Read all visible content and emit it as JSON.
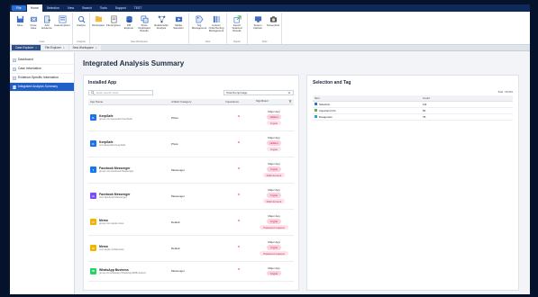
{
  "ribbon_tabs": {
    "file": "File",
    "tabs": [
      "Home",
      "Selection",
      "View",
      "Search",
      "Tools",
      "Support",
      "TEST"
    ]
  },
  "ribbon_groups": [
    {
      "name": "Case",
      "buttons": [
        {
          "label": "Save",
          "icon": "save-icon"
        },
        {
          "label": "Close Case",
          "icon": "close-case-icon"
        },
        {
          "label": "Add Evidence",
          "icon": "add-evidence-icon"
        },
        {
          "label": "Case Explorer",
          "icon": "case-explorer-icon"
        }
      ]
    },
    {
      "name": "Analysis",
      "buttons": [
        {
          "label": "Analyze",
          "icon": "analyze-icon"
        }
      ]
    },
    {
      "name": "New Workspace",
      "buttons": [
        {
          "label": "Workspace",
          "icon": "workspace-icon"
        },
        {
          "label": "File Explorer",
          "icon": "file-explorer-icon"
        },
        {
          "label": "DB Explorer",
          "icon": "db-explorer-icon"
        },
        {
          "label": "Show Duplicated Results",
          "icon": "duplicated-results-icon"
        },
        {
          "label": "Relationship Analysis",
          "icon": "relationship-icon"
        },
        {
          "label": "Media Selection",
          "icon": "media-selection-icon"
        }
      ]
    },
    {
      "name": "View",
      "buttons": [
        {
          "label": "Tag Management",
          "icon": "tag-management-icon"
        },
        {
          "label": "Column Order/Sorting Management",
          "icon": "column-order-icon"
        }
      ]
    },
    {
      "name": "Report",
      "buttons": [
        {
          "label": "Export Selected Results",
          "icon": "export-icon"
        }
      ]
    },
    {
      "name": "Tools",
      "buttons": [
        {
          "label": "Screen Capture",
          "icon": "screen-capture-icon"
        },
        {
          "label": "Screenshot",
          "icon": "screenshot-icon"
        }
      ]
    }
  ],
  "doc_tabs": [
    {
      "label": "Case Explorer",
      "active": true
    },
    {
      "label": "File Explorer",
      "active": false
    },
    {
      "label": "New Workspace",
      "active": false
    }
  ],
  "sidebar": {
    "items": [
      {
        "label": "Dashboard",
        "active": false
      },
      {
        "label": "Case Information",
        "active": false
      },
      {
        "label": "Evidence-Specific Information",
        "active": false
      },
      {
        "label": "Integrated Analysis Summary",
        "active": true
      }
    ]
  },
  "page_title": "Integrated Analysis Summary",
  "installed": {
    "title": "Installed App",
    "search_placeholder": "Enter search word",
    "select_value": "Total Dumpimage",
    "columns": [
      "App Name",
      "Artifact Category",
      "Importance",
      "Significant"
    ],
    "rows": [
      {
        "name": "KeepSafe",
        "pkg": "group.com.keepsafe.KeepSafe",
        "category": "Photo",
        "logo": "K",
        "logo_color": "#1a73e8",
        "tag_title": "Major App",
        "tags": [
          "Hidden",
          "Crypto"
        ]
      },
      {
        "name": "KeepSafe",
        "pkg": "com.keepsafe.KeepSafe",
        "category": "Photo",
        "logo": "K",
        "logo_color": "#1a73e8",
        "tag_title": "Major App",
        "tags": [
          "Hidden",
          "Crypto"
        ]
      },
      {
        "name": "Facebook Messenger",
        "pkg": "group.com.facebook.Messenger",
        "category": "Messenger",
        "logo": "f",
        "logo_color": "#1877f2",
        "tag_title": "Major App",
        "tags": [
          "Crypto",
          "Multi Account"
        ]
      },
      {
        "name": "Facebook Messenger",
        "pkg": "com.facebook.Messenger",
        "category": "Messenger",
        "logo": "m",
        "logo_color": "#7b4cff",
        "tag_title": "Major App",
        "tags": [
          "Crypto",
          "Multi Account"
        ]
      },
      {
        "name": "Memo",
        "pkg": "group.com.apple.notes",
        "category": "Default",
        "logo": "N",
        "logo_color": "#f2b400",
        "tag_title": "Major App",
        "tags": [
          "Crypto",
          "Password required"
        ]
      },
      {
        "name": "Memo",
        "pkg": "com.apple.mobilenotes",
        "category": "Default",
        "logo": "N",
        "logo_color": "#f2b400",
        "tag_title": "Major App",
        "tags": [
          "Crypto",
          "Password required"
        ]
      },
      {
        "name": "WhatsApp Business",
        "pkg": "group.net.whatsapp.WhatsAppSMB.shared",
        "category": "Messenger",
        "logo": "W",
        "logo_color": "#25d366",
        "tag_title": "Major App",
        "tags": [
          "Crypto"
        ]
      }
    ]
  },
  "selection": {
    "title": "Selection and Tag",
    "total": "Total : 65,832",
    "columns": [
      "Item",
      "Count"
    ],
    "rows": [
      {
        "item": "Selection",
        "count": "111",
        "color": "#2f6fd6"
      },
      {
        "item": "Important Info",
        "count": "56",
        "color": "#5db35d"
      },
      {
        "item": "Dangerous",
        "count": "78",
        "color": "#2fa3c9"
      }
    ]
  },
  "colors": {
    "accent": "#1f5fc7",
    "tag_bg": "#fde3ea",
    "importance": "#e0245e"
  }
}
